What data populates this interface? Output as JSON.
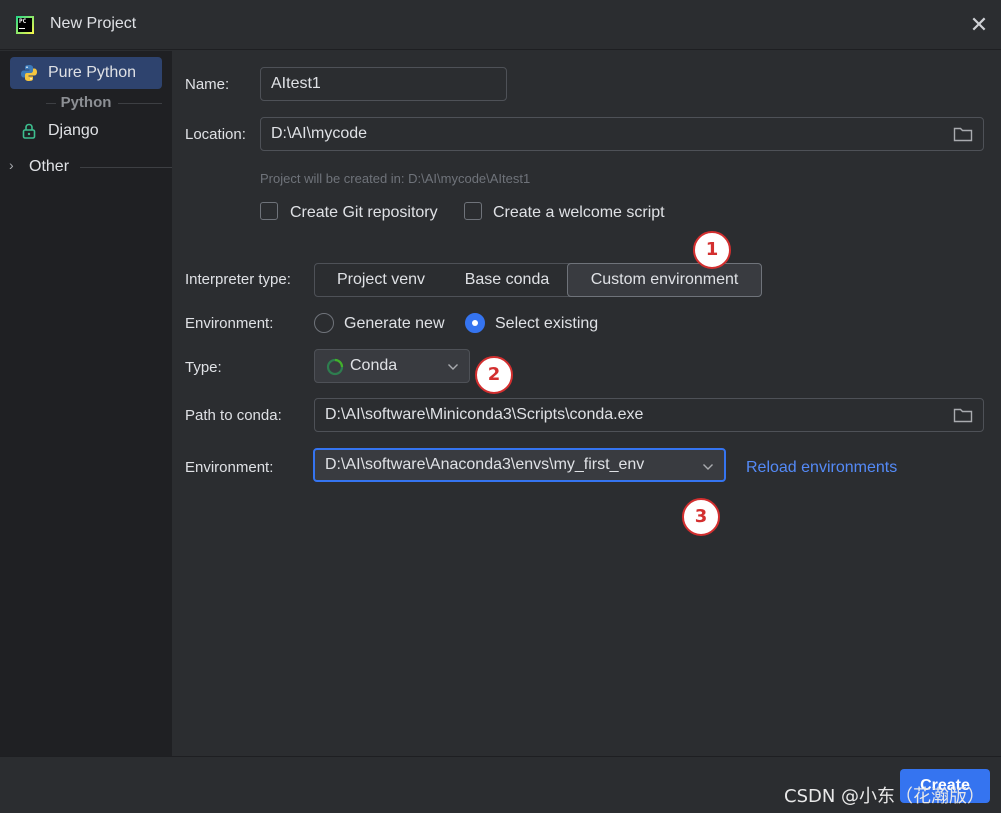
{
  "window": {
    "title": "New Project"
  },
  "sidebar": {
    "items": [
      {
        "label": "Pure Python",
        "selected": true
      },
      {
        "label": "Django",
        "selected": false
      }
    ],
    "group_label": "Python",
    "other_label": "Other"
  },
  "form": {
    "name_label": "Name:",
    "name_value": "AItest1",
    "location_label": "Location:",
    "location_value": "D:\\AI\\mycode",
    "location_hint": "Project will be created in: D:\\AI\\mycode\\AItest1",
    "git_checkbox_label": "Create Git repository",
    "welcome_checkbox_label": "Create a welcome script",
    "interpreter_label": "Interpreter type:",
    "interpreter_options": [
      "Project venv",
      "Base conda",
      "Custom environment"
    ],
    "interpreter_selected": "Custom environment",
    "environment_label": "Environment:",
    "env_radio_generate": "Generate new",
    "env_radio_existing": "Select existing",
    "type_label": "Type:",
    "type_value": "Conda",
    "path_conda_label": "Path to conda:",
    "path_conda_value": "D:\\AI\\software\\Miniconda3\\Scripts\\conda.exe",
    "env_select_label": "Environment:",
    "env_select_value": "D:\\AI\\software\\Anaconda3\\envs\\my_first_env",
    "reload_link": "Reload environments"
  },
  "annotations": [
    "1",
    "2",
    "3"
  ],
  "footer": {
    "create_label": "Create",
    "watermark": "CSDN @小东（花瀚版）"
  },
  "colors": {
    "accent": "#3574f0",
    "link": "#548af7",
    "sidebar_selected": "#2e436e",
    "badge_red": "#d32f2f"
  }
}
